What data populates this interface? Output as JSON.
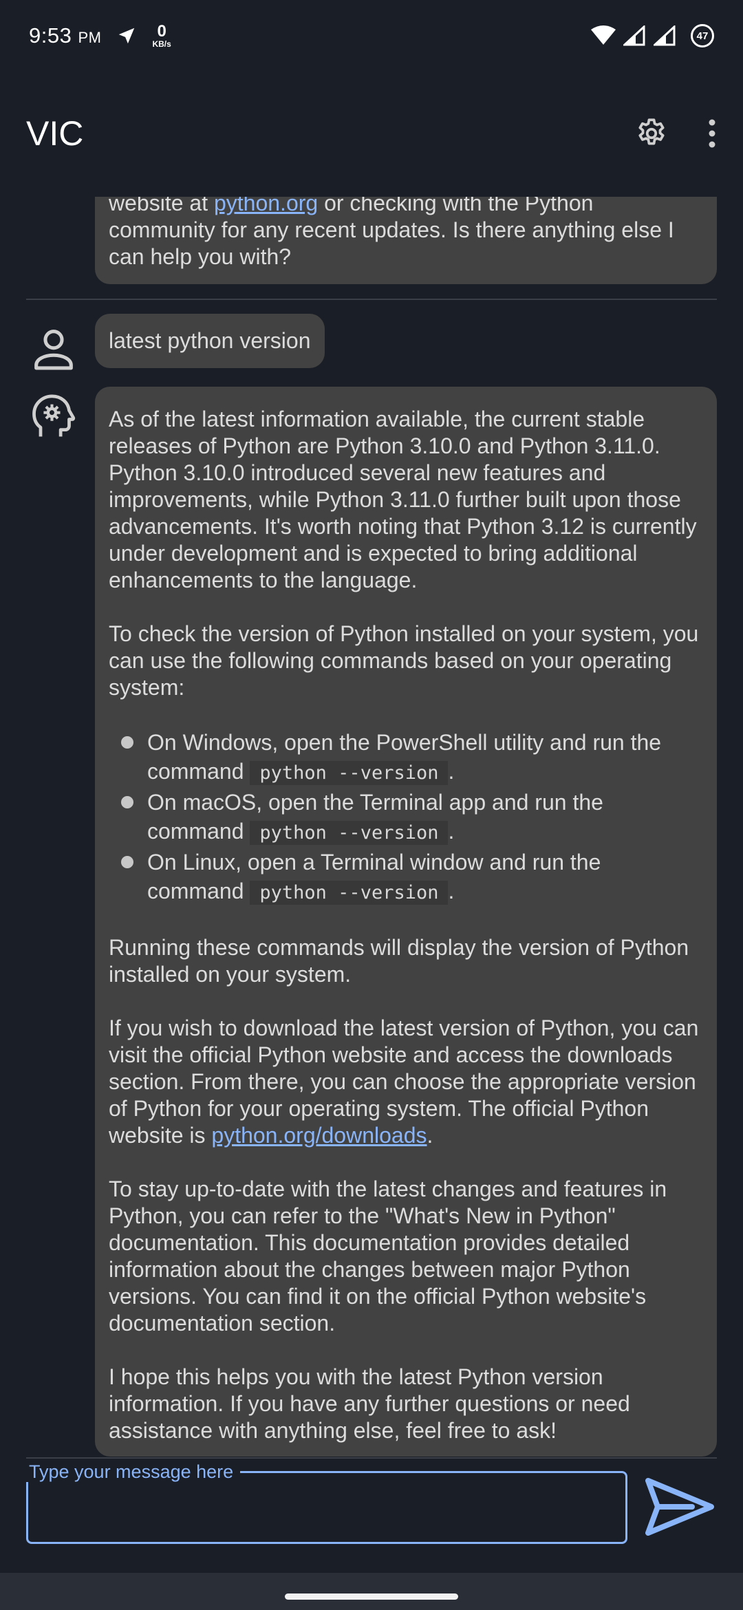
{
  "status_bar": {
    "time": "9:53",
    "ampm": "PM",
    "net_speed": "0",
    "net_unit": "KB/s",
    "battery": "47",
    "icons": [
      "navigation-icon",
      "wifi-icon",
      "signal-icon",
      "signal-icon-2"
    ]
  },
  "app_bar": {
    "title": "VIC",
    "actions": [
      "settings-icon",
      "more-vert-icon"
    ]
  },
  "chat": {
    "previous_message": {
      "before_link": "website at ",
      "link": "python.org",
      "after_link": " or checking with the Python community for any recent updates. Is there anything else I can help you with?"
    },
    "user_message": "latest python version",
    "bot_message": {
      "p1": "As of the latest information available, the current stable releases of Python are Python 3.10.0 and Python 3.11.0. Python 3.10.0 introduced several new features and improvements, while Python 3.11.0 further built upon those advancements. It's worth noting that Python 3.12 is currently under development and is expected to bring additional enhancements to the language.",
      "p2": "To check the version of Python installed on your system, you can use the following commands based on your operating system:",
      "bullets": [
        {
          "text": "On Windows, open the PowerShell utility and run the command ",
          "code": "python --version",
          "end": "."
        },
        {
          "text": "On macOS, open the Terminal app and run the command ",
          "code": "python --version",
          "end": "."
        },
        {
          "text": "On Linux, open a Terminal window and run the command ",
          "code": "python --version",
          "end": "."
        }
      ],
      "p3": "Running these commands will display the version of Python installed on your system.",
      "p4_before_link": "If you wish to download the latest version of Python, you can visit the official Python website and access the downloads section. From there, you can choose the appropriate version of Python for your operating system. The official Python website is ",
      "p4_link": "python.org/downloads",
      "p4_after_link": ".",
      "p5": "To stay up-to-date with the latest changes and features in Python, you can refer to the \"What's New in Python\" documentation. This documentation provides detailed information about the changes between major Python versions. You can find it on the official Python website's documentation section.",
      "p6": "I hope this helps you with the latest Python version information. If you have any further questions or need assistance with anything else, feel free to ask!"
    }
  },
  "input": {
    "label": "Type your message here",
    "value": ""
  },
  "colors": {
    "background": "#1a1e26",
    "bubble": "#424242",
    "accent": "#8ab4f8",
    "text": "#dcdcdc"
  }
}
